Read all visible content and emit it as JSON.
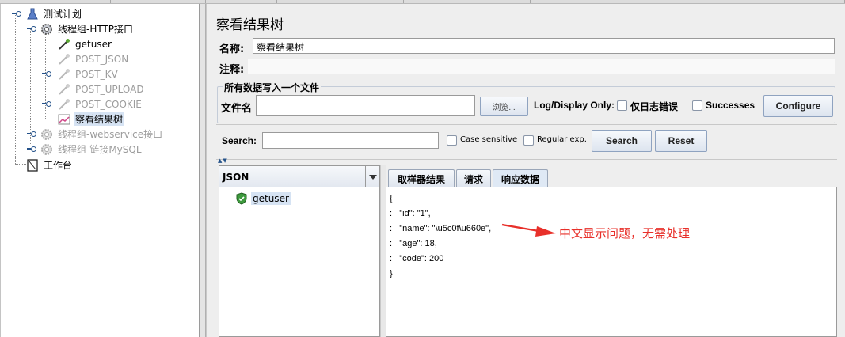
{
  "tree": {
    "root": {
      "label": "测试计划"
    },
    "groups": [
      {
        "label": "线程组-HTTP接口",
        "children": [
          {
            "label": "getuser"
          },
          {
            "label": "POST_JSON"
          },
          {
            "label": "POST_KV"
          },
          {
            "label": "POST_UPLOAD"
          },
          {
            "label": "POST_COOKIE"
          },
          {
            "label": "察看结果树"
          }
        ]
      },
      {
        "label": "线程组-webservice接口"
      },
      {
        "label": "线程组-链接MySQL"
      }
    ],
    "workbench": {
      "label": "工作台"
    }
  },
  "panel": {
    "title": "察看结果树",
    "name_label": "名称:",
    "name_value": "察看结果树",
    "comment_label": "注释:",
    "comment_value": "",
    "file_section": {
      "legend": "所有数据写入一个文件",
      "filename_label": "文件名",
      "filename_value": "",
      "browse_label": "浏览...",
      "log_display_label": "Log/Display Only:",
      "errors_only_label": "仅日志错误",
      "successes_label": "Successes",
      "configure_label": "Configure"
    },
    "search": {
      "label": "Search:",
      "value": "",
      "case_sensitive_label": "Case sensitive",
      "regex_label": "Regular exp.",
      "search_button": "Search",
      "reset_button": "Reset"
    }
  },
  "results": {
    "renderer": "JSON",
    "items": [
      {
        "label": "getuser"
      }
    ]
  },
  "detail_tabs": [
    {
      "label": "取样器结果"
    },
    {
      "label": "请求"
    },
    {
      "label": "响应数据"
    }
  ],
  "response_lines": [
    "{",
    ":   \"id\": \"1\",",
    ":   \"name\": \"\\u5c0f\\u660e\",",
    ":   \"age\": 18,",
    ":   \"code\": 200",
    "}"
  ],
  "annotation": {
    "text": "中文显示问题，无需处理",
    "color": "#e8302a"
  }
}
